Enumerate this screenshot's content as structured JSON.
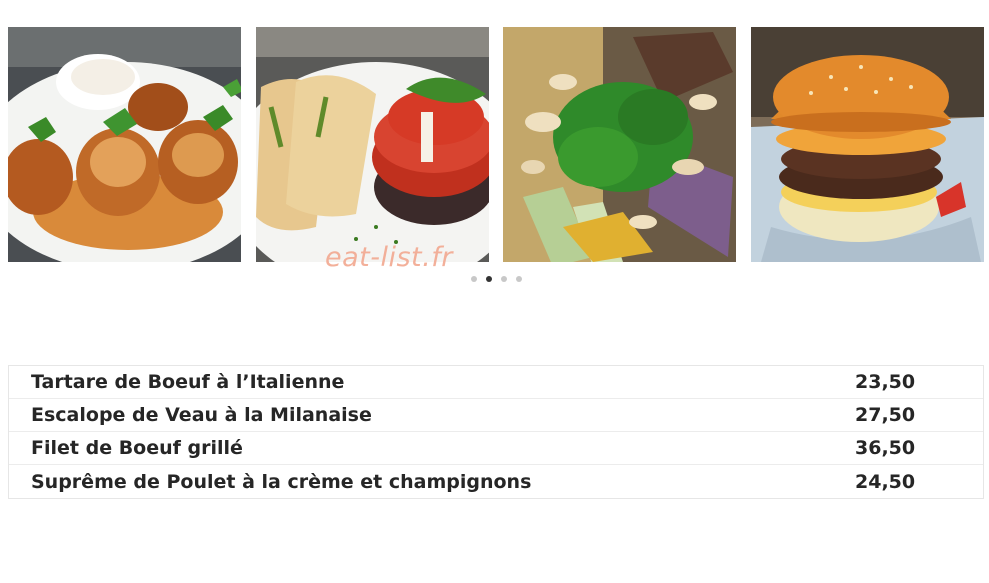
{
  "gallery": {
    "images": [
      {
        "subject": "poulet-creme-riz"
      },
      {
        "subject": "aubergine-parmigiana-bruschetta"
      },
      {
        "subject": "magret-amandes-coriandre"
      },
      {
        "subject": "burger-double-steak"
      }
    ],
    "watermark": "eat-list.fr",
    "dots": [
      {
        "active": false
      },
      {
        "active": true
      },
      {
        "active": false
      },
      {
        "active": false
      }
    ]
  },
  "menu": {
    "items": [
      {
        "name": "Tartare de Boeuf à l’Italienne",
        "price": "23,50"
      },
      {
        "name": "Escalope de Veau à la Milanaise",
        "price": "27,50"
      },
      {
        "name": "Filet de Boeuf grillé",
        "price": "36,50"
      },
      {
        "name": "Suprême de Poulet à la crème et champignons",
        "price": "24,50"
      }
    ]
  },
  "colors": {
    "text": "#262626",
    "watermark": "#f2a890",
    "dot_active": "#333333",
    "dot_inactive": "#c8c8c8",
    "border": "#e6e6e6"
  }
}
